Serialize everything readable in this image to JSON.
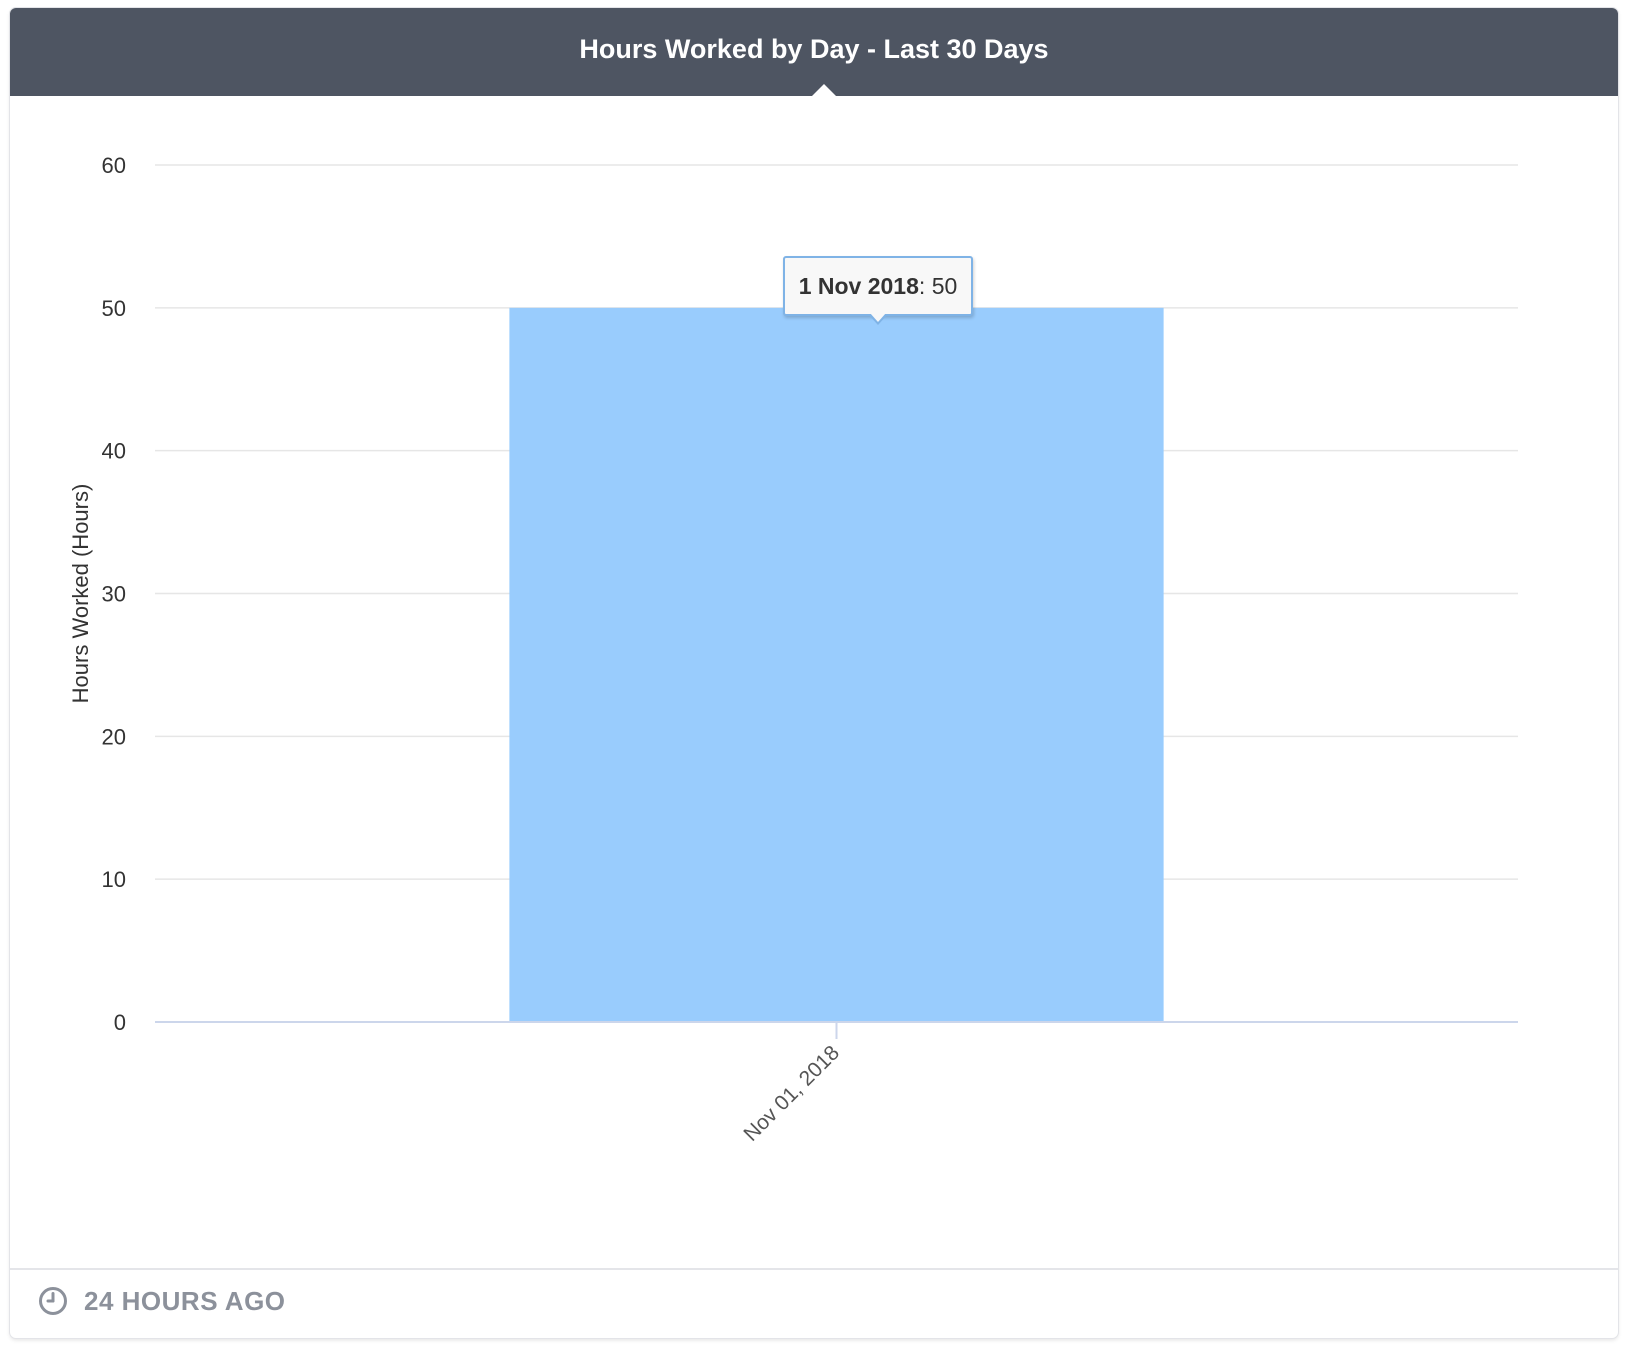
{
  "card": {
    "title": "Hours Worked by Day - Last 30 Days",
    "footer_text": "24 HOURS AGO",
    "footer_icon": "clock-icon"
  },
  "tooltip": {
    "date": "1 Nov 2018",
    "value": "50"
  },
  "colors": {
    "header_bg": "#4e5562",
    "bar": "#99ccfd",
    "grid": "#e6e6e6",
    "axis": "#ccd6eb",
    "tooltip_border": "#7fb3e6"
  },
  "chart_data": {
    "type": "bar",
    "title": "Hours Worked by Day - Last 30 Days",
    "xlabel": "",
    "ylabel": "Hours Worked (Hours)",
    "categories": [
      "Nov 01, 2018"
    ],
    "values": [
      50
    ],
    "ylim": [
      0,
      60
    ],
    "yticks": [
      0,
      10,
      20,
      30,
      40,
      50,
      60
    ],
    "grid": true,
    "legend": "none"
  }
}
